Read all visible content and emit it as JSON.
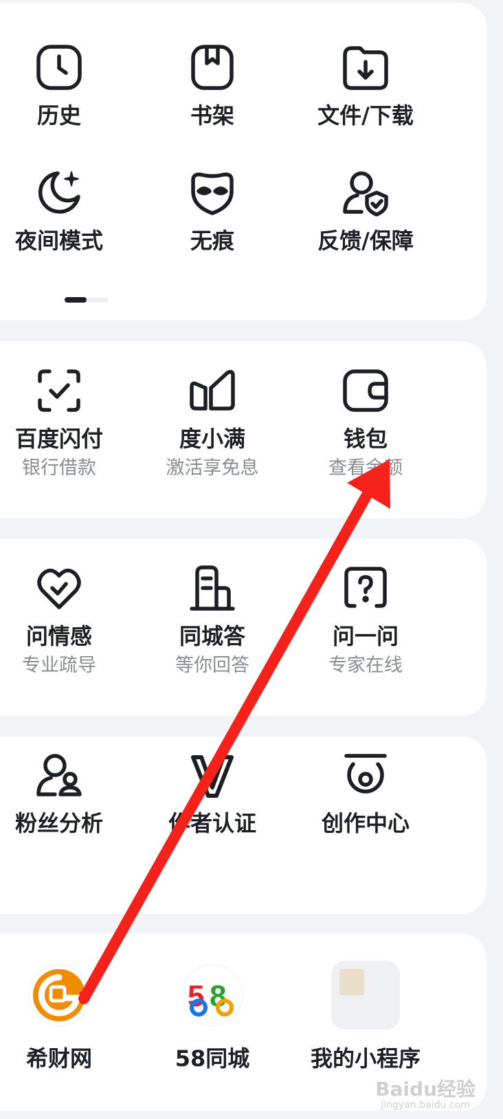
{
  "card1": {
    "items": [
      {
        "label": "历史",
        "icon": "clock-icon"
      },
      {
        "label": "书架",
        "icon": "bookshelf-icon"
      },
      {
        "label": "文件/下载",
        "icon": "download-folder-icon"
      },
      {
        "label": "夜间模式",
        "icon": "moon-icon"
      },
      {
        "label": "无痕",
        "icon": "mask-icon"
      },
      {
        "label": "反馈/保障",
        "icon": "user-shield-icon"
      }
    ]
  },
  "card2": {
    "items": [
      {
        "label": "百度闪付",
        "sub": "银行借款",
        "icon": "scan-check-icon"
      },
      {
        "label": "度小满",
        "sub": "激活享免息",
        "icon": "duxiaoman-icon"
      },
      {
        "label": "钱包",
        "sub": "查看余额",
        "icon": "wallet-icon"
      }
    ]
  },
  "card3": {
    "items": [
      {
        "label": "问情感",
        "sub": "专业疏导",
        "icon": "heart-icon"
      },
      {
        "label": "同城答",
        "sub": "等你回答",
        "icon": "building-icon"
      },
      {
        "label": "问一问",
        "sub": "专家在线",
        "icon": "question-icon"
      }
    ]
  },
  "card4": {
    "items": [
      {
        "label": "粉丝分析",
        "icon": "fans-icon"
      },
      {
        "label": "作者认证",
        "icon": "verified-v-icon"
      },
      {
        "label": "创作中心",
        "icon": "creator-icon"
      }
    ]
  },
  "card5": {
    "items": [
      {
        "label": "希财网",
        "icon": "xicai-logo-icon"
      },
      {
        "label": "58同城",
        "icon": "58-logo-icon"
      },
      {
        "label": "我的小程序",
        "icon": "mini-program-icon"
      }
    ]
  },
  "logo_58": {
    "five": "5",
    "eight": "8"
  },
  "watermark": {
    "main": "Baidu经验",
    "sub": "jingyan.baidu.com"
  },
  "colors": {
    "background": "#f2f3f7",
    "card": "#ffffff",
    "text": "#1e1f24",
    "subtext": "#8a8c93",
    "arrow": "#f5221b",
    "xicai": "#f08c00"
  }
}
